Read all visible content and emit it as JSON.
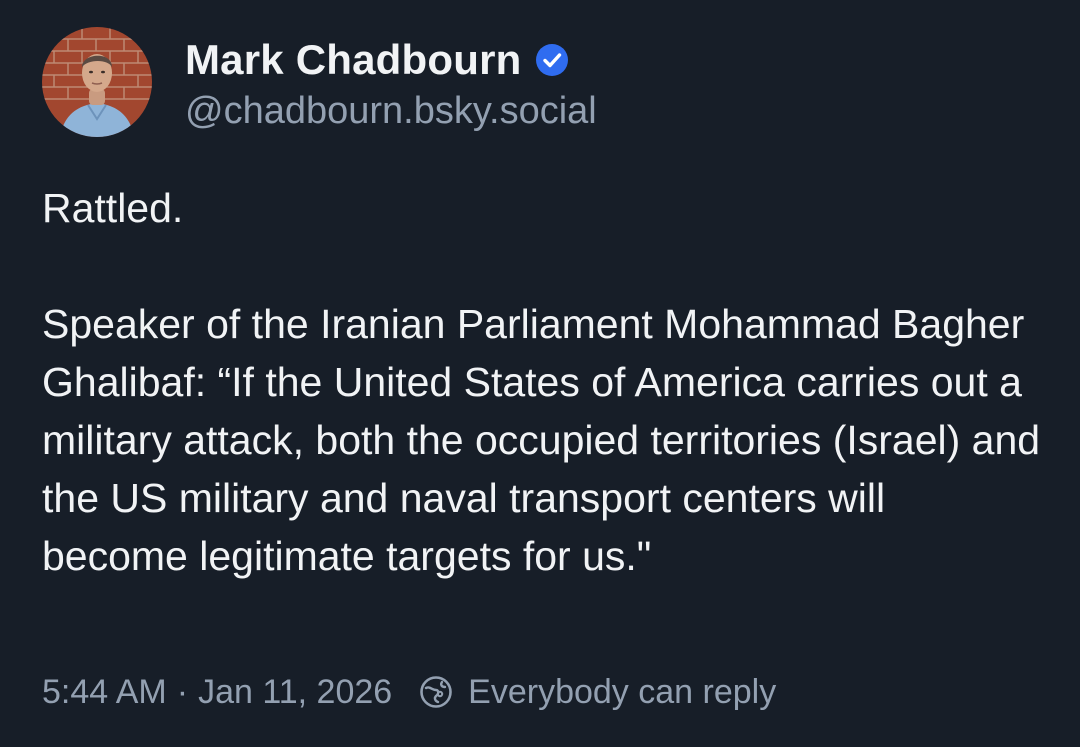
{
  "author": {
    "display_name": "Mark Chadbourn",
    "handle": "@chadbourn.bsky.social",
    "verified": true,
    "verified_color": "#2f6cf0"
  },
  "post": {
    "text": "Rattled.\n\nSpeaker of the Iranian Parliament Mohammad Bagher Ghalibaf: “If the United States of America carries out a military attack, both the occupied territories (Israel) and the US military and naval transport centers will become legitimate targets for us.\""
  },
  "meta": {
    "time": "5:44 AM",
    "separator": "·",
    "date": "Jan 11, 2026",
    "reply_setting": "Everybody can reply",
    "reply_icon": "globe-icon"
  },
  "colors": {
    "background": "#171e28",
    "text": "#f1f3f5",
    "muted": "#93a0b1"
  }
}
